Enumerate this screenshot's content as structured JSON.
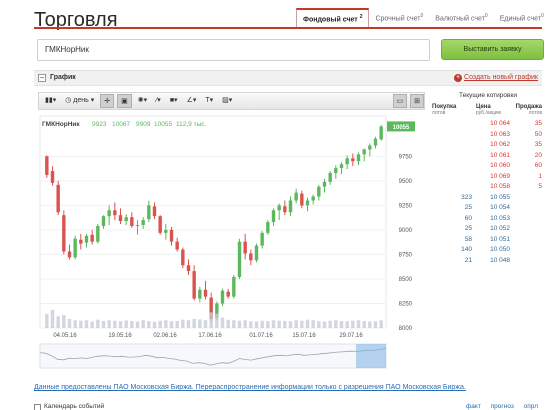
{
  "title": "Торговля",
  "tabs": [
    {
      "label": "Фондовый счет",
      "count": "2",
      "active": true
    },
    {
      "label": "Срочный счет",
      "count": "0",
      "active": false
    },
    {
      "label": "Валютный счет",
      "count": "0",
      "active": false
    },
    {
      "label": "Единый счет",
      "count": "0",
      "active": false
    }
  ],
  "search": {
    "value": "ГМКНорНик"
  },
  "order_button": "Выставить заявку",
  "panel": {
    "title": "График",
    "create_link": "Создать новый график"
  },
  "toolbar": {
    "period": "день"
  },
  "legend": {
    "ticker": "ГМКНорНик",
    "open": "9923",
    "high": "10067",
    "low": "9909",
    "close": "10055",
    "volume": "112,9 тыс."
  },
  "colors": {
    "up": "#5cb85c",
    "down": "#d9534f",
    "accent": "#c0392b"
  },
  "chart_data": {
    "type": "candlestick",
    "x_labels": [
      "04.05.16",
      "19.05.16",
      "02.06.16",
      "17.06.16",
      "01.07.16",
      "15.07.16",
      "29.07.16"
    ],
    "y_ticks": [
      "9750",
      "9500",
      "9250",
      "9000",
      "8750",
      "8500",
      "8250",
      "8000"
    ],
    "ylim": [
      8000,
      10100
    ],
    "current_price": "10055",
    "candles": [
      [
        9750,
        9760,
        9530,
        9560
      ],
      [
        9600,
        9650,
        9450,
        9480
      ],
      [
        9460,
        9500,
        9150,
        9180
      ],
      [
        9150,
        9200,
        8750,
        8780
      ],
      [
        8780,
        8850,
        8700,
        8720
      ],
      [
        8720,
        8940,
        8700,
        8910
      ],
      [
        8900,
        8960,
        8800,
        8860
      ],
      [
        8870,
        8960,
        8820,
        8940
      ],
      [
        8950,
        9000,
        8850,
        8880
      ],
      [
        8880,
        9060,
        8860,
        9040
      ],
      [
        9040,
        9150,
        9010,
        9140
      ],
      [
        9140,
        9250,
        9050,
        9200
      ],
      [
        9200,
        9280,
        9100,
        9150
      ],
      [
        9150,
        9220,
        9060,
        9090
      ],
      [
        9090,
        9160,
        9050,
        9130
      ],
      [
        9130,
        9180,
        9020,
        9040
      ],
      [
        9040,
        9100,
        8950,
        9050
      ],
      [
        9050,
        9130,
        9010,
        9100
      ],
      [
        9110,
        9300,
        9080,
        9250
      ],
      [
        9240,
        9280,
        9110,
        9140
      ],
      [
        9140,
        9150,
        8950,
        8970
      ],
      [
        8970,
        9060,
        8900,
        9000
      ],
      [
        9000,
        9030,
        8840,
        8880
      ],
      [
        8880,
        8920,
        8780,
        8800
      ],
      [
        8800,
        8820,
        8610,
        8640
      ],
      [
        8640,
        8700,
        8540,
        8580
      ],
      [
        8580,
        8640,
        8280,
        8300
      ],
      [
        8300,
        8420,
        8260,
        8390
      ],
      [
        8390,
        8480,
        8290,
        8320
      ],
      [
        8310,
        8360,
        8060,
        8090
      ],
      [
        8100,
        8270,
        8080,
        8250
      ],
      [
        8250,
        8400,
        8220,
        8380
      ],
      [
        8370,
        8400,
        8300,
        8320
      ],
      [
        8320,
        8540,
        8300,
        8520
      ],
      [
        8520,
        8910,
        8500,
        8880
      ],
      [
        8880,
        8960,
        8700,
        8760
      ],
      [
        8760,
        8800,
        8640,
        8690
      ],
      [
        8690,
        8860,
        8670,
        8840
      ],
      [
        8840,
        8990,
        8810,
        8970
      ],
      [
        8970,
        9100,
        8950,
        9080
      ],
      [
        9080,
        9220,
        9040,
        9200
      ],
      [
        9200,
        9270,
        9100,
        9250
      ],
      [
        9240,
        9300,
        9150,
        9180
      ],
      [
        9180,
        9340,
        9140,
        9300
      ],
      [
        9300,
        9420,
        9270,
        9380
      ],
      [
        9370,
        9400,
        9220,
        9250
      ],
      [
        9250,
        9330,
        9190,
        9300
      ],
      [
        9300,
        9360,
        9260,
        9340
      ],
      [
        9340,
        9460,
        9300,
        9440
      ],
      [
        9440,
        9520,
        9380,
        9490
      ],
      [
        9490,
        9600,
        9460,
        9580
      ],
      [
        9580,
        9660,
        9520,
        9630
      ],
      [
        9630,
        9690,
        9570,
        9670
      ],
      [
        9670,
        9760,
        9620,
        9730
      ],
      [
        9730,
        9780,
        9650,
        9700
      ],
      [
        9700,
        9790,
        9660,
        9770
      ],
      [
        9770,
        9830,
        9700,
        9820
      ],
      [
        9820,
        9880,
        9750,
        9860
      ],
      [
        9860,
        9950,
        9830,
        9930
      ],
      [
        9923,
        10067,
        9909,
        10055
      ]
    ],
    "volumes": [
      0.55,
      0.7,
      0.45,
      0.5,
      0.35,
      0.3,
      0.28,
      0.3,
      0.25,
      0.32,
      0.27,
      0.3,
      0.28,
      0.26,
      0.29,
      0.27,
      0.25,
      0.3,
      0.26,
      0.24,
      0.28,
      0.3,
      0.26,
      0.27,
      0.32,
      0.3,
      0.35,
      0.33,
      0.3,
      0.6,
      0.55,
      0.4,
      0.32,
      0.3,
      0.28,
      0.3,
      0.26,
      0.25,
      0.28,
      0.26,
      0.3,
      0.28,
      0.27,
      0.26,
      0.3,
      0.28,
      0.32,
      0.3,
      0.26,
      0.25,
      0.28,
      0.3,
      0.27,
      0.26,
      0.28,
      0.3,
      0.27,
      0.25,
      0.26,
      0.3
    ]
  },
  "quotes": {
    "title": "Текущие котировки",
    "headers": {
      "buy": "Покупка",
      "price": "Цена",
      "sell": "Продажа"
    },
    "subheaders": {
      "buy": "лотов",
      "price": "руб./акцию",
      "sell": "лотов"
    },
    "rows": [
      {
        "buy": "",
        "price": "10 064",
        "sell": "35",
        "side": "ask"
      },
      {
        "buy": "",
        "price": "10 063",
        "sell": "50",
        "side": "ask"
      },
      {
        "buy": "",
        "price": "10 062",
        "sell": "35",
        "side": "ask"
      },
      {
        "buy": "",
        "price": "10 061",
        "sell": "20",
        "side": "ask"
      },
      {
        "buy": "",
        "price": "10 060",
        "sell": "60",
        "side": "ask"
      },
      {
        "buy": "",
        "price": "10 069",
        "sell": "1",
        "side": "ask"
      },
      {
        "buy": "",
        "price": "10 058",
        "sell": "5",
        "side": "ask"
      },
      {
        "buy": "323",
        "price": "10 055",
        "sell": "",
        "side": "bid"
      },
      {
        "buy": "25",
        "price": "10 054",
        "sell": "",
        "side": "bid"
      },
      {
        "buy": "60",
        "price": "10 053",
        "sell": "",
        "side": "bid"
      },
      {
        "buy": "25",
        "price": "10 052",
        "sell": "",
        "side": "bid"
      },
      {
        "buy": "58",
        "price": "10 051",
        "sell": "",
        "side": "bid"
      },
      {
        "buy": "140",
        "price": "10 050",
        "sell": "",
        "side": "bid"
      },
      {
        "buy": "21",
        "price": "10 048",
        "sell": "",
        "side": "bid"
      }
    ]
  },
  "footer": {
    "source_note": "Данные предоставлены ПАО Московская Биржа. Перераспространение информации только с разрешения ПАО Московская Биржа.",
    "calendar": "Календарь событий",
    "links": [
      "факт",
      "прогноз",
      "опрл"
    ]
  }
}
